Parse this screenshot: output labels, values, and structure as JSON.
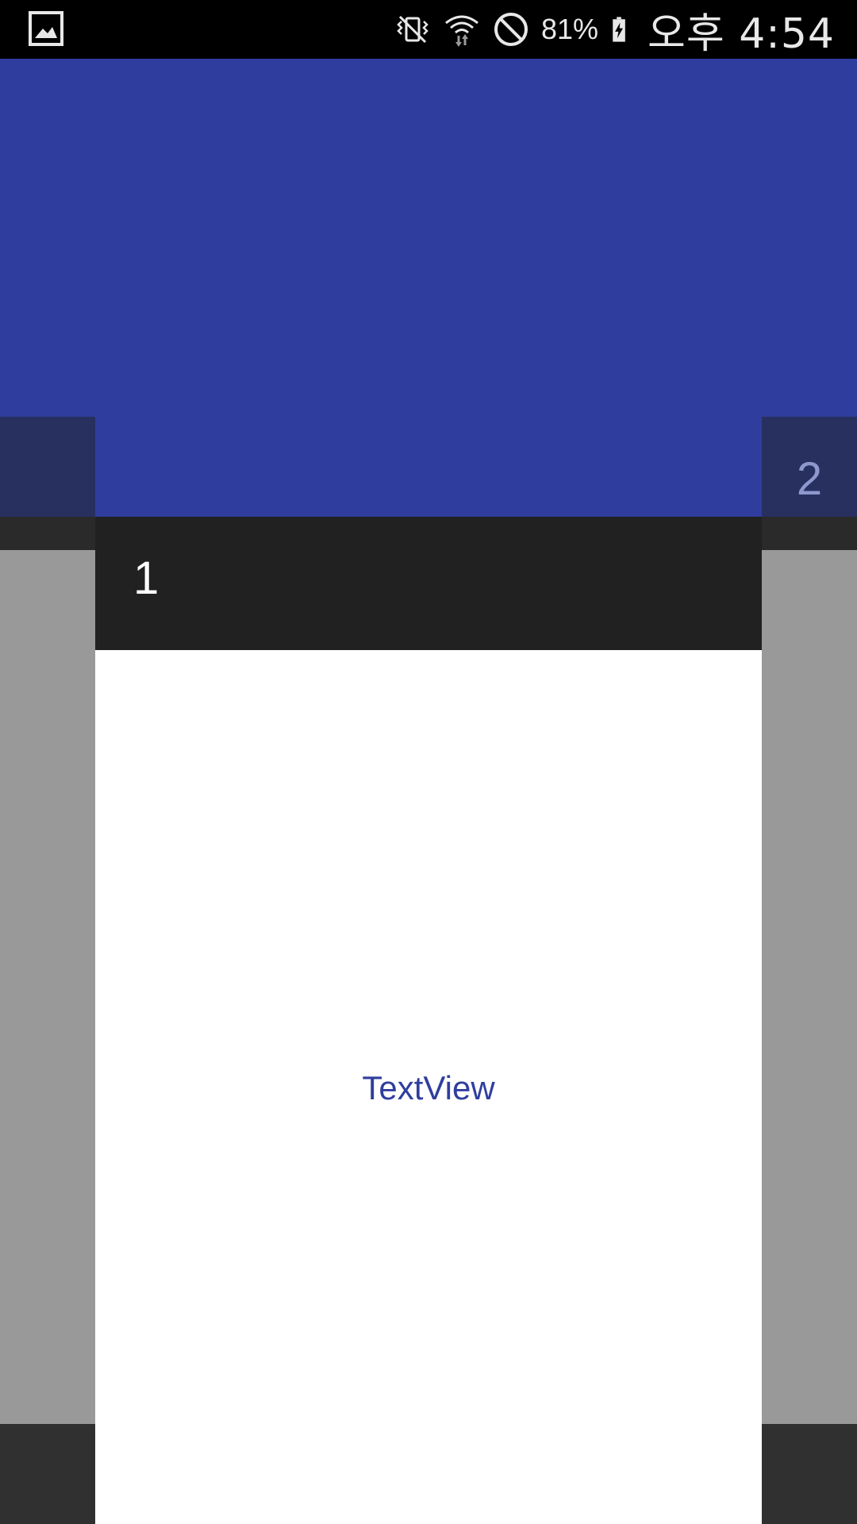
{
  "status_bar": {
    "icons": [
      "gallery-icon",
      "vibrate-mute-icon",
      "wifi-icon",
      "blocked-icon",
      "battery-charging-icon"
    ],
    "battery_percent": "81%",
    "time": "오후 4:54"
  },
  "pager": {
    "current_page_label": "1",
    "next_page_label": "2"
  },
  "card": {
    "body_text": "TextView"
  },
  "colors": {
    "primary": "#2f3e9e",
    "title_bar": "#212121",
    "side_gray": "#999999",
    "card_background": "#ffffff"
  }
}
